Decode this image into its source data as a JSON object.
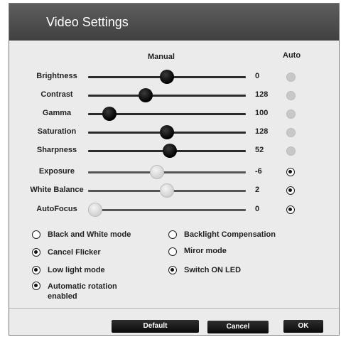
{
  "window": {
    "title": "Video Settings"
  },
  "headers": {
    "manual": "Manual",
    "auto": "Auto"
  },
  "sliders": [
    {
      "label": "Brightness",
      "value": "0",
      "level": 0.5,
      "enabled": true,
      "auto": "disabled"
    },
    {
      "label": "Contrast",
      "value": "128",
      "level": 0.35,
      "enabled": true,
      "auto": "disabled"
    },
    {
      "label": "Gamma",
      "value": "100",
      "level": 0.1,
      "enabled": true,
      "auto": "disabled"
    },
    {
      "label": "Saturation",
      "value": "128",
      "level": 0.5,
      "enabled": true,
      "auto": "disabled"
    },
    {
      "label": "Sharpness",
      "value": "52",
      "level": 0.52,
      "enabled": true,
      "auto": "disabled"
    },
    {
      "label": "Exposure",
      "value": "-6",
      "level": 0.43,
      "enabled": false,
      "auto": "on"
    },
    {
      "label": "White Balance",
      "value": "2",
      "level": 0.5,
      "enabled": false,
      "auto": "on"
    },
    {
      "label": "AutoFocus",
      "value": "0",
      "level": 0.0,
      "enabled": false,
      "auto": "on"
    }
  ],
  "options_left": [
    {
      "label": "Black and White mode",
      "checked": false
    },
    {
      "label": "Cancel Flicker",
      "checked": true
    },
    {
      "label": "Low light mode",
      "checked": true
    },
    {
      "label": "Automatic rotation enabled",
      "checked": true
    }
  ],
  "options_right": [
    {
      "label": "Backlight Compensation",
      "checked": false
    },
    {
      "label": "Miror mode",
      "checked": false
    },
    {
      "label": "Switch ON LED",
      "checked": true
    }
  ],
  "buttons": {
    "default": "Default",
    "cancel": "Cancel",
    "ok": "OK"
  }
}
